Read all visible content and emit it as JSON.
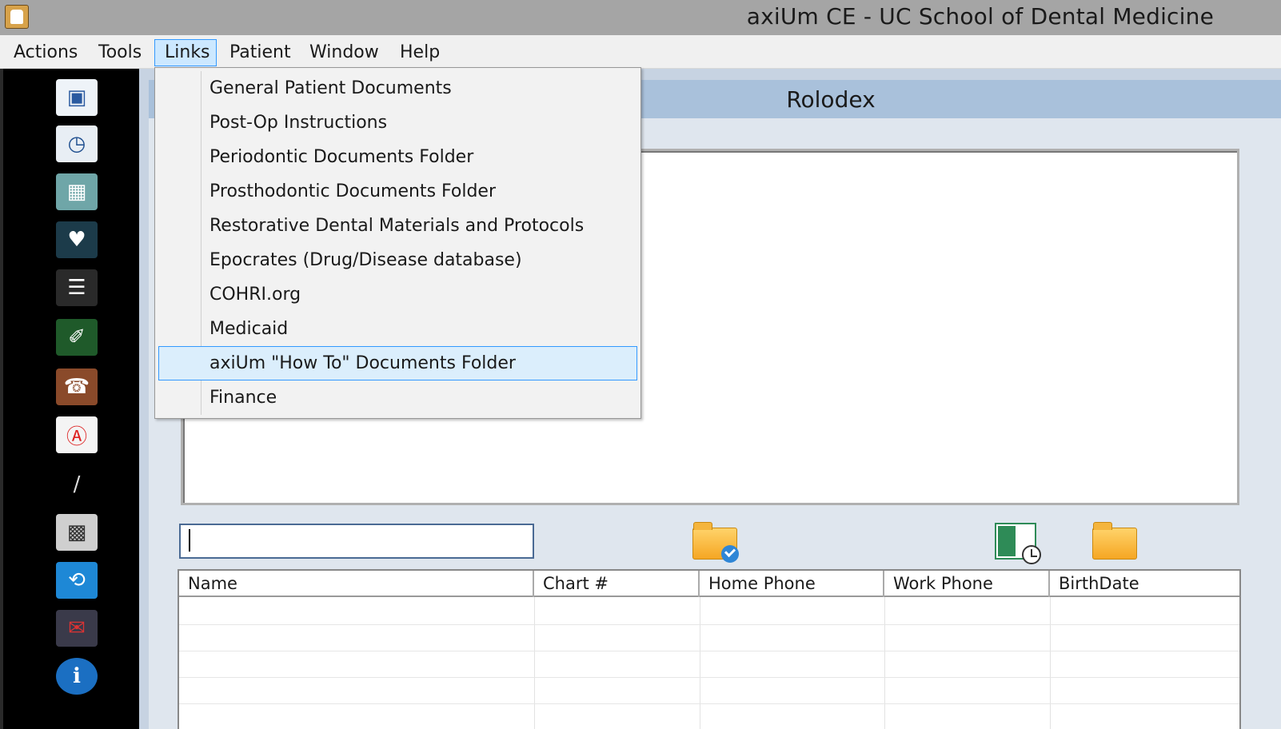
{
  "window": {
    "title": "axiUm CE - UC School of Dental Medicine"
  },
  "menubar": {
    "items": [
      {
        "label": "Actions"
      },
      {
        "label": "Tools"
      },
      {
        "label": "Links"
      },
      {
        "label": "Patient"
      },
      {
        "label": "Window"
      },
      {
        "label": "Help"
      }
    ],
    "active_item": "Links"
  },
  "links_menu": {
    "items": [
      {
        "label": "General Patient Documents"
      },
      {
        "label": "Post-Op Instructions"
      },
      {
        "label": "Periodontic Documents Folder"
      },
      {
        "label": "Prosthodontic Documents Folder"
      },
      {
        "label": "Restorative Dental Materials and Protocols"
      },
      {
        "label": "Epocrates (Drug/Disease database)"
      },
      {
        "label": "COHRI.org"
      },
      {
        "label": "Medicaid"
      },
      {
        "label": "axiUm \"How To\" Documents Folder"
      },
      {
        "label": "Finance"
      }
    ],
    "highlighted_item": "axiUm \"How To\" Documents Folder"
  },
  "toolbar": {
    "icons": [
      "rolodex-card-icon",
      "appointment-book-icon",
      "calculator-icon",
      "tooth-icon",
      "teeth-chart-icon",
      "clip-document-icon",
      "address-book-icon",
      "form-alert-icon",
      "dental-instruments-icon",
      "xray-icon",
      "reload-arrow-icon",
      "mail-icon",
      "info-icon"
    ]
  },
  "rolodex": {
    "title": "Rolodex",
    "search": {
      "value": ""
    },
    "table": {
      "columns": [
        "Name",
        "Chart #",
        "Home Phone",
        "Work Phone",
        "BirthDate"
      ],
      "rows": []
    }
  },
  "colors": {
    "titlebar": "#a5a5a5",
    "menu_highlight": "#cce8ff",
    "menu_highlight_border": "#3399ff",
    "rolodex_header": "#a9c1db",
    "toolbar_bg": "#000000"
  }
}
